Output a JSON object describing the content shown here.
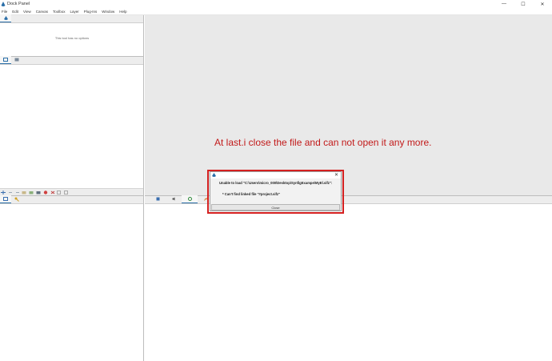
{
  "window": {
    "title": "Dock Panel",
    "controls": {
      "minimize": "—",
      "maximize": "☐",
      "close": "✕"
    }
  },
  "menu": {
    "items": [
      "File",
      "Edit",
      "View",
      "Canvas",
      "Toolbox",
      "Layer",
      "Plug-Ins",
      "Window",
      "Help"
    ]
  },
  "tool_options": {
    "empty_text": "This tool has no options"
  },
  "annotation": {
    "text": "At last.i close the file and can not open it any more.",
    "color": "#c21a1a"
  },
  "dialog": {
    "message": "Unable to load \"C:\\Users\\micro_000\\Desktop\\SynfigExampe\\MyEl.sifz\":",
    "detail": "* Can't find linked file \"#project.sifz\"",
    "close_button": "Close"
  },
  "colors": {
    "accent": "#2a6ea8",
    "highlight": "#d42020",
    "canvas_bg": "#e9e9e9"
  }
}
